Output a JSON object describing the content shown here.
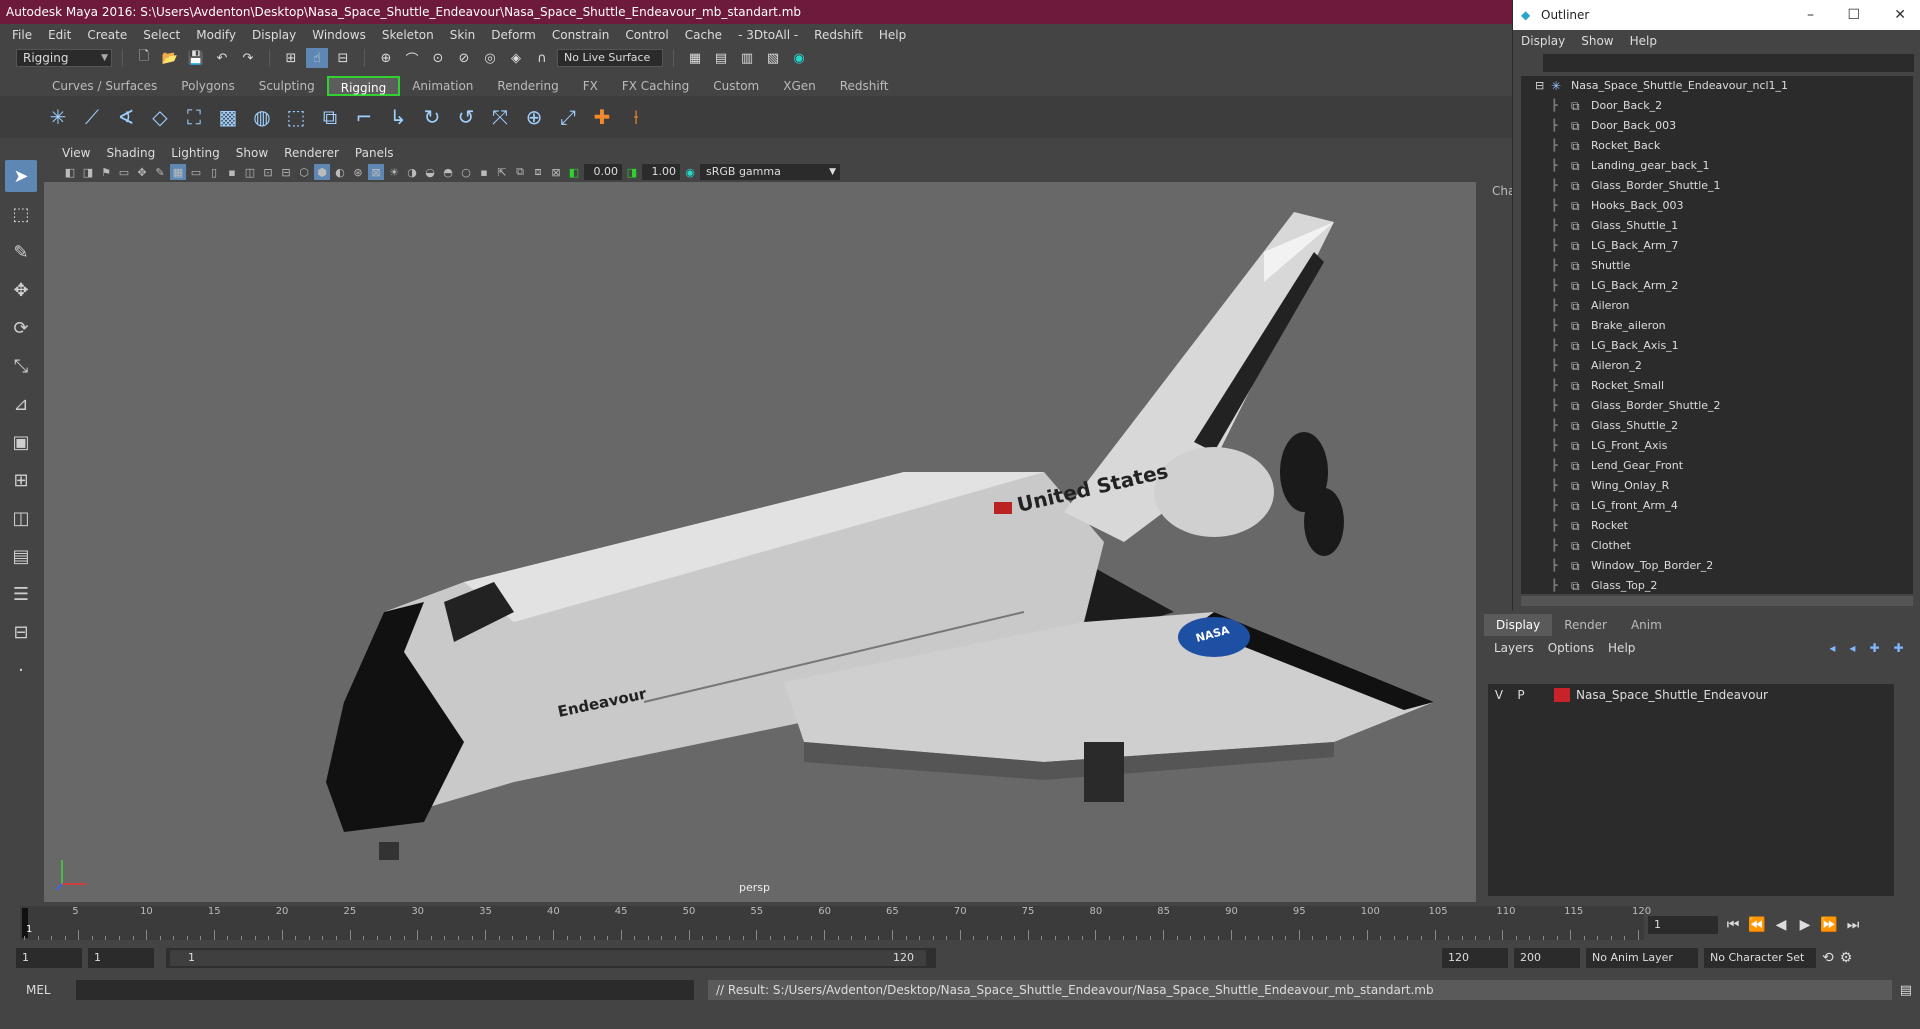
{
  "window": {
    "title": "Autodesk Maya 2016: S:\\Users\\Avdenton\\Desktop\\Nasa_Space_Shuttle_Endeavour\\Nasa_Space_Shuttle_Endeavour_mb_standart.mb"
  },
  "menubar": [
    "File",
    "Edit",
    "Create",
    "Select",
    "Modify",
    "Display",
    "Windows",
    "Skeleton",
    "Skin",
    "Deform",
    "Constrain",
    "Control",
    "Cache",
    "- 3DtoAll -",
    "Redshift",
    "Help"
  ],
  "statusline": {
    "mode": "Rigging",
    "live_surface": "No Live Surface"
  },
  "shelf": {
    "tabs": [
      "Curves / Surfaces",
      "Polygons",
      "Sculpting",
      "Rigging",
      "Animation",
      "Rendering",
      "FX",
      "FX Caching",
      "Custom",
      "XGen",
      "Redshift"
    ],
    "active_tab": "Rigging"
  },
  "viewport": {
    "menus": [
      "View",
      "Shading",
      "Lighting",
      "Show",
      "Renderer",
      "Panels"
    ],
    "exposure": "0.00",
    "gamma": "1.00",
    "color_space": "sRGB gamma",
    "camera": "persp",
    "model_labels": {
      "country": "United States",
      "name": "Endeavour",
      "agency": "NASA"
    }
  },
  "channel_box": {
    "label": "Cha"
  },
  "outliner": {
    "title": "Outliner",
    "menus": [
      "Display",
      "Show",
      "Help"
    ],
    "root": "Nasa_Space_Shuttle_Endeavour_ncl1_1",
    "items": [
      "Door_Back_2",
      "Door_Back_003",
      "Rocket_Back",
      "Landing_gear_back_1",
      "Glass_Border_Shuttle_1",
      "Hooks_Back_003",
      "Glass_Shuttle_1",
      "LG_Back_Arm_7",
      "Shuttle",
      "LG_Back_Arm_2",
      "Aileron",
      "Brake_aileron",
      "LG_Back_Axis_1",
      "Aileron_2",
      "Rocket_Small",
      "Glass_Border_Shuttle_2",
      "Glass_Shuttle_2",
      "LG_Front_Axis",
      "Lend_Gear_Front",
      "Wing_Onlay_R",
      "LG_front_Arm_4",
      "Rocket",
      "Clothet",
      "Window_Top_Border_2",
      "Glass_Top_2"
    ]
  },
  "layer_editor": {
    "tabs": [
      "Display",
      "Render",
      "Anim"
    ],
    "active_tab": "Display",
    "menus": [
      "Layers",
      "Options",
      "Help"
    ],
    "layers": [
      {
        "v": "V",
        "p": "P",
        "name": "Nasa_Space_Shuttle_Endeavour",
        "color": "#c8222b"
      }
    ]
  },
  "timeline": {
    "ticks": [
      "5",
      "10",
      "15",
      "20",
      "25",
      "30",
      "35",
      "40",
      "45",
      "50",
      "55",
      "60",
      "65",
      "70",
      "75",
      "80",
      "85",
      "90",
      "95",
      "100",
      "105",
      "110",
      "115",
      "120"
    ],
    "current_label": "1",
    "current_frame": "1"
  },
  "range": {
    "start": "1",
    "playback_start": "1",
    "range_start": "1",
    "range_end": "120",
    "playback_end": "120",
    "end": "200",
    "anim_layer": "No Anim Layer",
    "character_set": "No Character Set"
  },
  "command": {
    "language": "MEL",
    "result": "// Result: S:/Users/Avdenton/Desktop/Nasa_Space_Shuttle_Endeavour/Nasa_Space_Shuttle_Endeavour_mb_standart.mb"
  },
  "colors": {
    "title_bar": "#6e1a3c",
    "active_shelf_border": "#2fd22f",
    "active_tool": "#5e88b3",
    "layer_color": "#c8222b"
  }
}
